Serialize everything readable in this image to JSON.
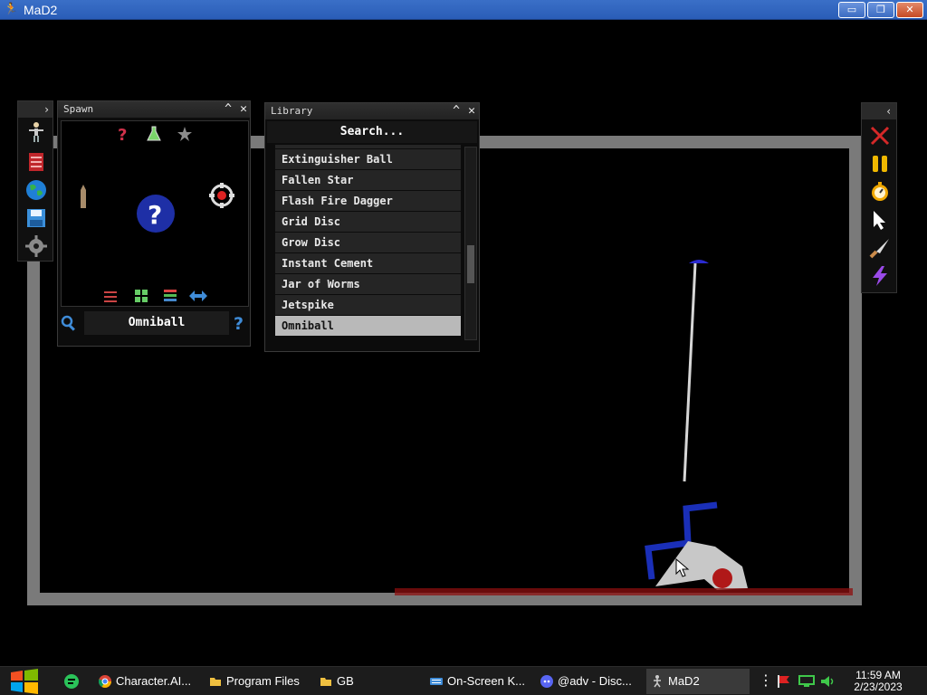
{
  "window": {
    "title": "MaD2",
    "controls": {
      "minimize": "▭",
      "maximize": "❐",
      "close": "✕"
    }
  },
  "left_toolbar": {
    "toggle": "›",
    "items": [
      {
        "name": "human-icon"
      },
      {
        "name": "book-icon"
      },
      {
        "name": "globe-icon"
      },
      {
        "name": "save-icon"
      },
      {
        "name": "settings-gear-icon"
      }
    ]
  },
  "spawn_panel": {
    "title": "Spawn",
    "minimize": "^",
    "close": "✕",
    "top_icons": [
      "question-mark-icon",
      "flask-icon",
      "star-icon"
    ],
    "bottom_icons": [
      "sliders-icon",
      "grid-icon",
      "layers-icon",
      "swap-arrows-icon"
    ],
    "search_value": "Omniball"
  },
  "library_panel": {
    "title": "Library",
    "minimize": "^",
    "close": "✕",
    "search_placeholder": "Search...",
    "items": [
      "Extinguisher Ball",
      "Fallen Star",
      "Flash Fire Dagger",
      "Grid Disc",
      "Grow Disc",
      "Instant Cement",
      "Jar of Worms",
      "Jetspike",
      "Omniball"
    ],
    "selected": "Omniball"
  },
  "right_toolbar": {
    "toggle": "‹",
    "items": [
      "close-x-icon",
      "pause-icon",
      "stopwatch-icon",
      "cursor-icon",
      "knife-icon",
      "lightning-icon"
    ]
  },
  "taskbar": {
    "tasks": [
      {
        "label": "Character.AI...",
        "icon": "chrome-icon"
      },
      {
        "label": "Program Files",
        "icon": "folder-icon"
      },
      {
        "label": "GB",
        "icon": "folder-icon"
      },
      {
        "label": "On-Screen K...",
        "icon": "keyboard-icon"
      },
      {
        "label": "@adv - Disc...",
        "icon": "discord-icon"
      },
      {
        "label": "MaD2",
        "icon": "mad2-icon"
      }
    ],
    "clock_time": "11:59 AM",
    "clock_date": "2/23/2023"
  }
}
